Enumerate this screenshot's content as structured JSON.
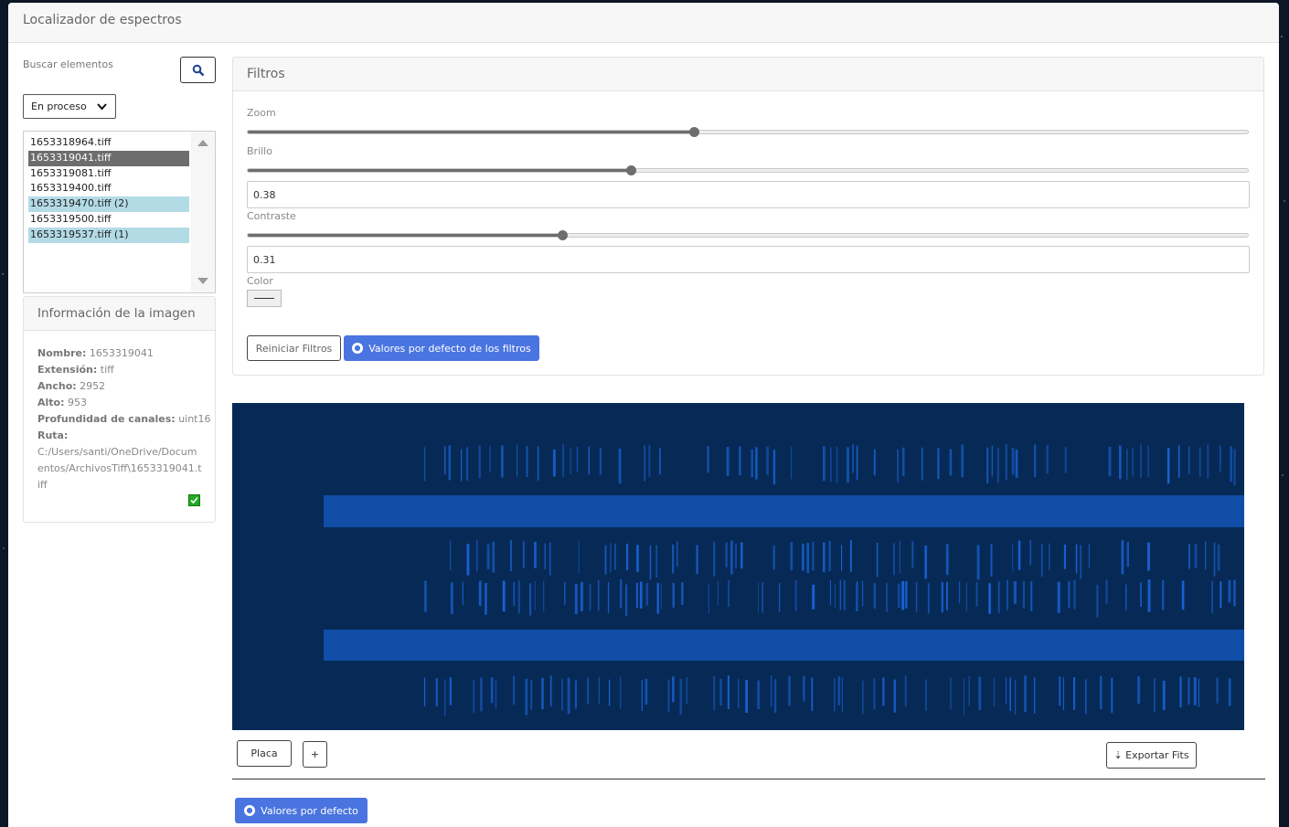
{
  "app": {
    "title": "Localizador de espectros"
  },
  "sidebar": {
    "search_label": "Buscar elementos",
    "status_select": "En proceso",
    "files": [
      {
        "name": "1653318964.tiff",
        "state": "normal"
      },
      {
        "name": "1653319041.tiff",
        "state": "selected"
      },
      {
        "name": "1653319081.tiff",
        "state": "normal"
      },
      {
        "name": "1653319400.tiff",
        "state": "normal"
      },
      {
        "name": "1653319470.tiff (2)",
        "state": "marked"
      },
      {
        "name": "1653319500.tiff",
        "state": "normal"
      },
      {
        "name": "1653319537.tiff (1)",
        "state": "marked"
      }
    ]
  },
  "info": {
    "title": "Información de la imagen",
    "name_label": "Nombre:",
    "name": "1653319041",
    "ext_label": "Extensión:",
    "ext": "tiff",
    "width_label": "Ancho:",
    "width": "2952",
    "height_label": "Alto:",
    "height": "953",
    "depth_label": "Profundidad de canales:",
    "depth": "uint16",
    "path_label": "Ruta:",
    "path": "C:/Users/santi/OneDrive/Documentos/ArchivosTiff\\1653319041.tiff",
    "checked": true
  },
  "filters": {
    "title": "Filtros",
    "zoom_label": "Zoom",
    "zoom_level": 0.446,
    "brightness_label": "Brillo",
    "brightness_level": 0.383,
    "brightness_value": "0.38",
    "contrast_label": "Contraste",
    "contrast_level": 0.314,
    "contrast_value": "0.31",
    "color_label": "Color",
    "reset_label": "Reiniciar Filtros",
    "defaults_label": "Valores por defecto de los filtros"
  },
  "bottom": {
    "plate_label": "Placa",
    "add_label": "+",
    "export_label": "⇣ Exportar Fits",
    "defaults_label": "Valores por defecto"
  },
  "colors": {
    "accent": "#4a74e0",
    "spectrum_bg": "#062a55",
    "spectrum_line": "#1a62d6"
  }
}
